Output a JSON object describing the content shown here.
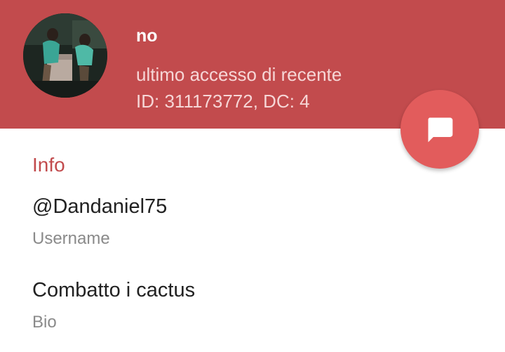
{
  "profile": {
    "name": "no",
    "status": "ultimo accesso di recente",
    "ids": "ID: 311173772, DC: 4"
  },
  "info_section": {
    "title": "Info",
    "username": {
      "value": "@Dandaniel75",
      "label": "Username"
    },
    "bio": {
      "value": "Combatto i cactus",
      "label": "Bio"
    }
  },
  "colors": {
    "header": "#c24b4d",
    "fab": "#e25c5c",
    "accent": "#c24b4d"
  },
  "icons": {
    "fab": "chat-bubble-icon"
  }
}
